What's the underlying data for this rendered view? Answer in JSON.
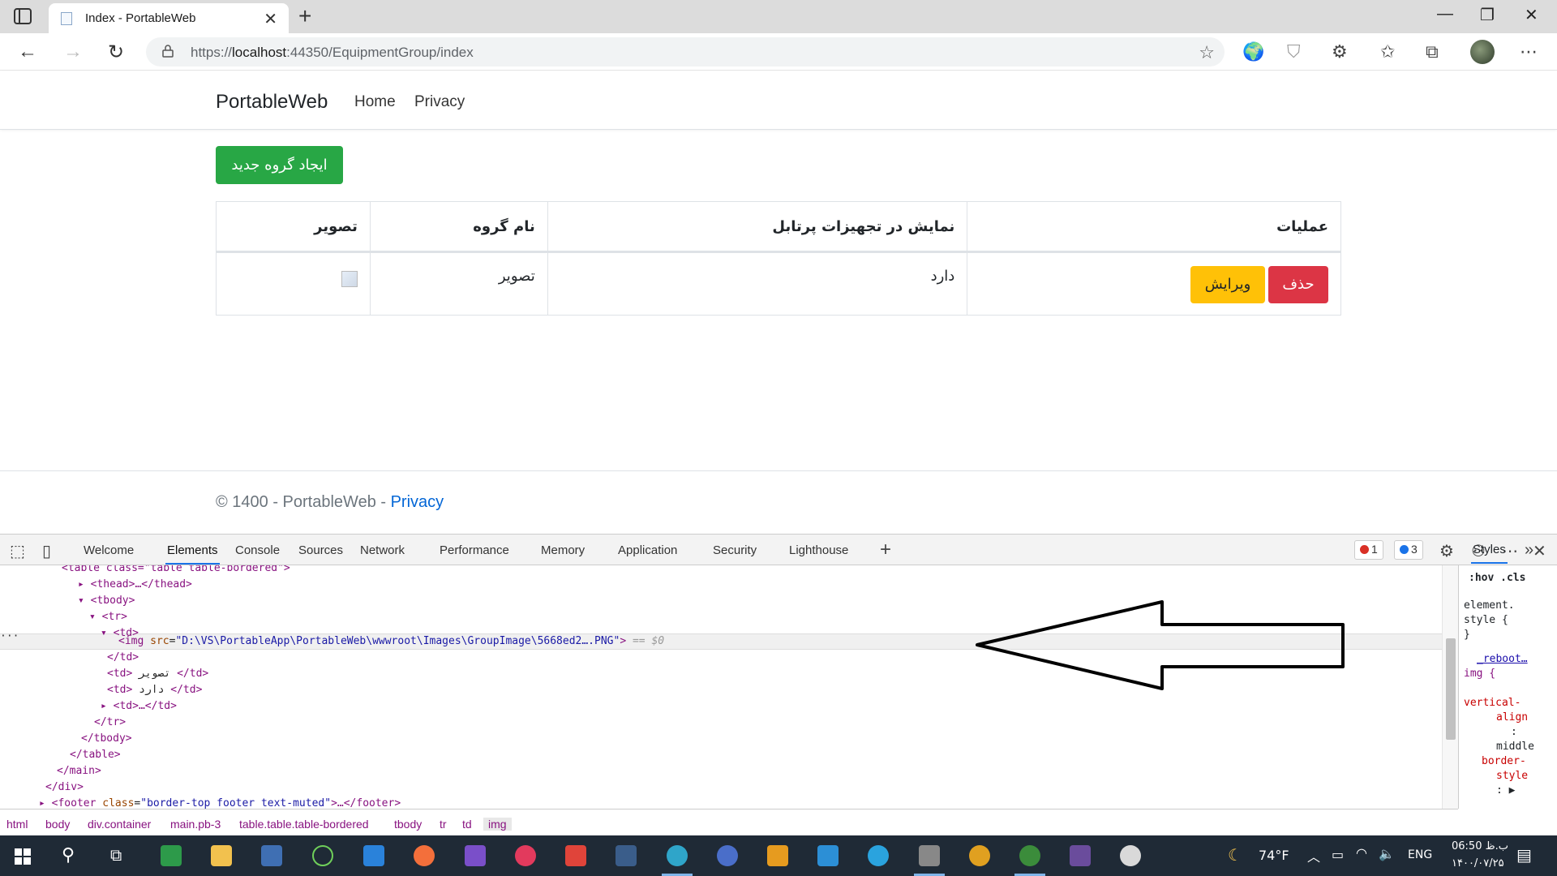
{
  "browser": {
    "tab_title": "Index - PortableWeb",
    "url_prefix": "https://",
    "url_host": "localhost",
    "url_rest": ":44350/EquipmentGroup/index"
  },
  "site": {
    "brand": "PortableWeb",
    "nav": [
      "Home",
      "Privacy"
    ],
    "create_button": "ایجاد گروه جدید",
    "table": {
      "headers": [
        "تصویر",
        "نام گروه",
        "نمایش در تجهیزات پرتابل",
        "عملیات"
      ],
      "row": {
        "name": "تصویر",
        "show": "دارد",
        "delete_label": "حذف",
        "edit_label": "ویرایش"
      }
    },
    "footer_text": "© 1400 - PortableWeb - ",
    "footer_link": "Privacy"
  },
  "devtools": {
    "tabs": [
      "Welcome",
      "Elements",
      "Console",
      "Sources",
      "Network",
      "Performance",
      "Memory",
      "Application",
      "Security",
      "Lighthouse"
    ],
    "active_tab": "Elements",
    "error_count": "1",
    "info_count": "3",
    "dom_lines": {
      "l0": "<table class=\"table table-bordered\">",
      "l1": "<thead>…</thead>",
      "l2": "<tbody>",
      "l3": "<tr>",
      "l4": "<td>",
      "l5_tag": "<img ",
      "l5_attr": "src",
      "l5_val": "\"D:\\VS\\PortableApp\\PortableWeb\\wwwroot\\Images\\GroupImage\\5668ed2….PNG\"",
      "l5_end": ">",
      "l5_dim": "== $0",
      "l6": "</td>",
      "l7_tag": "<td>",
      "l7_txt": " تصویر ",
      "l7_end": "</td>",
      "l8_tag": "<td>",
      "l8_txt": " دارد ",
      "l8_end": "</td>",
      "l9": "<td>…</td>",
      "l10": "</tr>",
      "l11": "</tbody>",
      "l12": "</table>",
      "l13": "</main>",
      "l14": "</div>",
      "l15_tag": "<footer ",
      "l15_attr": "class",
      "l15_val": "\"border-top footer text-muted\"",
      "l15_end": ">…</footer>"
    },
    "styles_tab": "Styles",
    "styles_lines": [
      ":hov  .cls",
      "element.",
      "style {",
      "}",
      "_reboot…",
      "img {",
      "vertical-",
      "align",
      ":",
      "middle",
      "border-",
      "style",
      ":"
    ],
    "breadcrumbs": [
      "html",
      "body",
      "div.container",
      "main.pb-3",
      "table.table.table-bordered",
      "tbody",
      "tr",
      "td",
      "img"
    ]
  },
  "taskbar": {
    "weather": "74°F",
    "lang": "ENG",
    "time": "06:50 ب.ظ",
    "date": "۱۴۰۰/۰۷/۲۵"
  }
}
